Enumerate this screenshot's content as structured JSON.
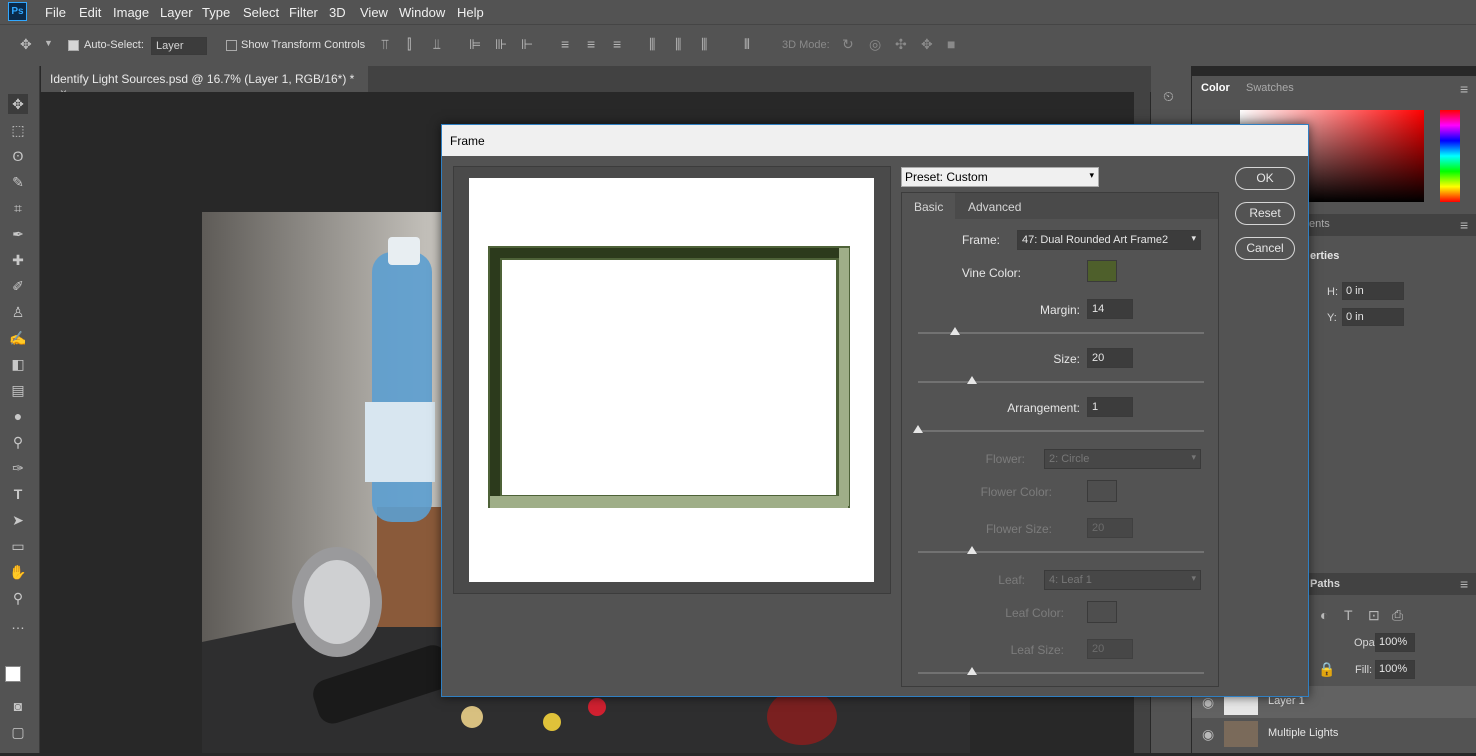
{
  "app": {
    "logo": "Ps"
  },
  "menu": [
    "File",
    "Edit",
    "Image",
    "Layer",
    "Type",
    "Select",
    "Filter",
    "3D",
    "View",
    "Window",
    "Help"
  ],
  "options": {
    "auto_select_label": "Auto-Select:",
    "auto_select_value": "Layer",
    "show_transform_label": "Show Transform Controls",
    "mode_3d": "3D Mode:"
  },
  "document": {
    "tab_title": "Identify Light Sources.psd @ 16.7% (Layer 1, RGB/16*) *",
    "close": "×"
  },
  "panels": {
    "color_tab": "Color",
    "swatches_tab": "Swatches",
    "adjust_tab": "ents",
    "properties_tab": "erties",
    "h_label": "H:",
    "h_value": "0 in",
    "y_label": "Y:",
    "y_value": "0 in",
    "paths_tab": "Paths",
    "opacity_label": "Opacity:",
    "opacity_value": "100%",
    "fill_label": "Fill:",
    "fill_value": "100%"
  },
  "layers": [
    {
      "name": "Layer 1"
    },
    {
      "name": "Multiple Lights"
    }
  ],
  "dialog": {
    "title": "Frame",
    "preset": "Preset: Custom",
    "tabs": [
      "Basic",
      "Advanced"
    ],
    "buttons": {
      "ok": "OK",
      "reset": "Reset",
      "cancel": "Cancel"
    },
    "frame_label": "Frame:",
    "frame_value": "47: Dual Rounded Art Frame2",
    "vine_color_label": "Vine Color:",
    "vine_color": "#4e5f2b",
    "margin_label": "Margin:",
    "margin_value": "14",
    "margin_level": 0.13,
    "size_label": "Size:",
    "size_value": "20",
    "size_level": 0.19,
    "arrangement_label": "Arrangement:",
    "arrangement_value": "1",
    "arrangement_level": 0.0,
    "flower_label": "Flower:",
    "flower_value": "2: Circle",
    "flower_color_label": "Flower Color:",
    "flower_size_label": "Flower Size:",
    "flower_size_value": "20",
    "flower_size_level": 0.19,
    "leaf_label": "Leaf:",
    "leaf_value": "4: Leaf 1",
    "leaf_color_label": "Leaf Color:",
    "leaf_size_label": "Leaf Size:",
    "leaf_size_value": "20",
    "leaf_size_level": 0.19
  }
}
